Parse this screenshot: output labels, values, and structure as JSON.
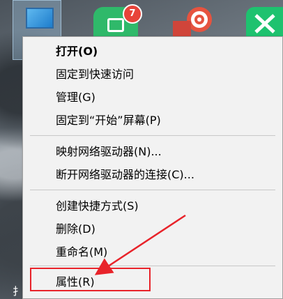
{
  "desktop": {
    "icons": [
      {
        "name": "this-pc-icon"
      },
      {
        "name": "shop-app-icon",
        "badge": "7"
      },
      {
        "name": "spiral-app-icon"
      },
      {
        "name": "green-x-app-icon"
      }
    ],
    "bottom_glyph": "扌"
  },
  "context_menu": {
    "items": [
      {
        "label": "打开(O)",
        "bold": true
      },
      {
        "label": "固定到快速访问"
      },
      {
        "label": "管理(G)"
      },
      {
        "label": "固定到“开始”屏幕(P)"
      },
      {
        "label": "映射网络驱动器(N)..."
      },
      {
        "label": "断开网络驱动器的连接(C)..."
      },
      {
        "label": "创建快捷方式(S)"
      },
      {
        "label": "删除(D)"
      },
      {
        "label": "重命名(M)"
      },
      {
        "label": "属性(R)",
        "annotated": true
      }
    ]
  },
  "annotation": {
    "color": "#e8232a"
  }
}
